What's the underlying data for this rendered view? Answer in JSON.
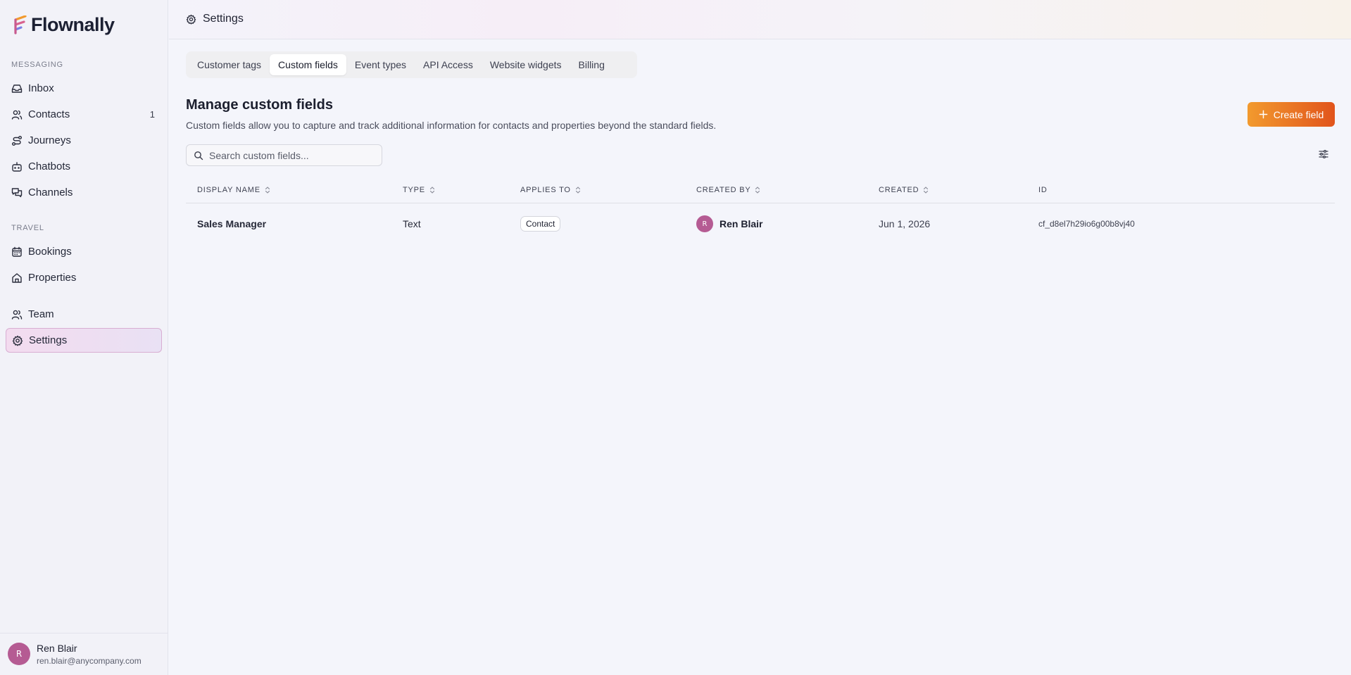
{
  "brand": {
    "name": "Flownally",
    "colors": [
      "#f29a2e",
      "#b55b93",
      "#6a7ae6"
    ]
  },
  "sidebar": {
    "sections": [
      {
        "label": "MESSAGING",
        "items": [
          {
            "label": "Inbox",
            "icon": "inbox-icon"
          },
          {
            "label": "Contacts",
            "icon": "users-icon",
            "count": "1"
          },
          {
            "label": "Journeys",
            "icon": "route-icon"
          },
          {
            "label": "Chatbots",
            "icon": "bot-icon"
          },
          {
            "label": "Channels",
            "icon": "messages-icon"
          }
        ]
      },
      {
        "label": "TRAVEL",
        "items": [
          {
            "label": "Bookings",
            "icon": "calendar-icon"
          },
          {
            "label": "Properties",
            "icon": "home-icon"
          }
        ]
      },
      {
        "label": "",
        "items": [
          {
            "label": "Team",
            "icon": "team-icon"
          },
          {
            "label": "Settings",
            "icon": "gear-icon",
            "active": true
          }
        ]
      }
    ],
    "user": {
      "initial": "R",
      "name": "Ren Blair",
      "email": "ren.blair@anycompany.com"
    }
  },
  "topbar": {
    "title": "Settings",
    "icon": "gear-icon"
  },
  "tabs": [
    {
      "label": "Customer tags"
    },
    {
      "label": "Custom fields",
      "active": true
    },
    {
      "label": "Event types"
    },
    {
      "label": "API Access"
    },
    {
      "label": "Website widgets"
    },
    {
      "label": "Billing"
    }
  ],
  "main": {
    "title": "Manage custom fields",
    "description": "Custom fields allow you to capture and track additional information for contacts and properties beyond the standard fields.",
    "create_label": "Create field",
    "search_placeholder": "Search custom fields...",
    "accent": "#e1541c"
  },
  "table": {
    "columns": [
      "DISPLAY NAME",
      "TYPE",
      "APPLIES TO",
      "CREATED BY",
      "CREATED",
      "ID"
    ],
    "rows": [
      {
        "display_name": "Sales Manager",
        "type": "Text",
        "applies_to": "Contact",
        "created_by": {
          "initial": "R",
          "name": "Ren Blair"
        },
        "created": "Jun 1, 2026",
        "id": "cf_d8el7h29io6g00b8vj40"
      }
    ]
  }
}
